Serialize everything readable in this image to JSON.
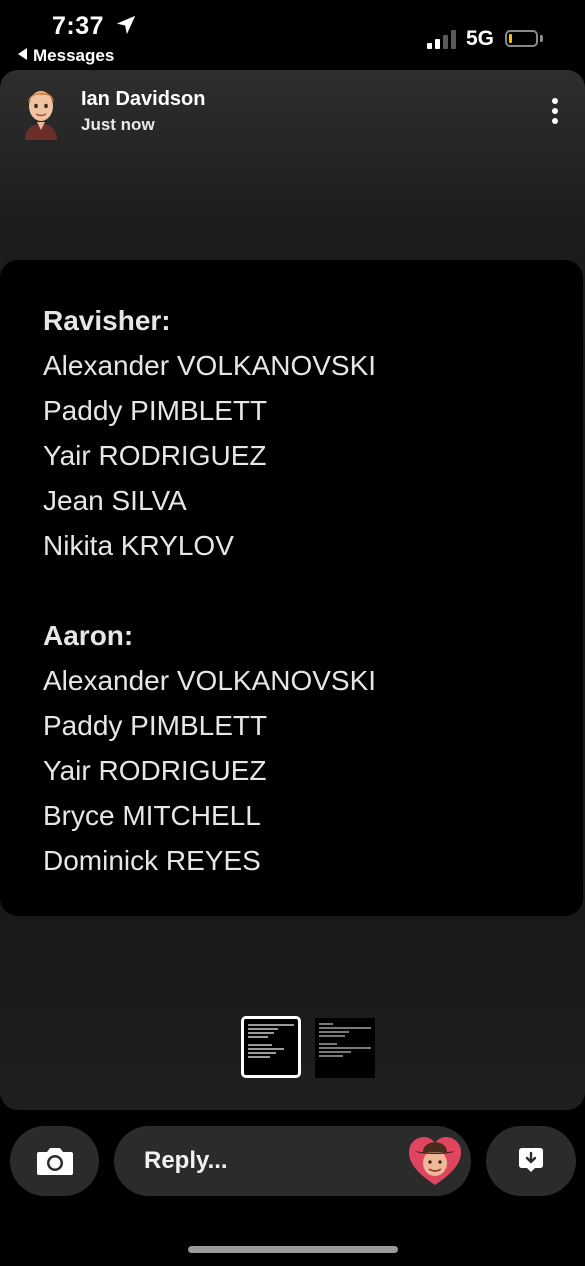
{
  "status": {
    "time": "7:37",
    "back_app": "Messages",
    "network": "5G",
    "battery_color": "#f4c200"
  },
  "story": {
    "sender_name": "Ian Davidson",
    "timestamp": "Just now",
    "more_icon": "more-vertical-icon",
    "lists": [
      {
        "heading": "Ravisher:",
        "items": [
          "Alexander VOLKANOVSKI",
          "Paddy PIMBLETT",
          "Yair RODRIGUEZ",
          "Jean SILVA",
          "Nikita KRYLOV"
        ]
      },
      {
        "heading": "Aaron:",
        "items": [
          "Alexander VOLKANOVSKI",
          "Paddy PIMBLETT",
          "Yair RODRIGUEZ",
          "Bryce MITCHELL",
          "Dominick REYES"
        ]
      }
    ],
    "thumbnails": 2,
    "active_thumbnail": 1
  },
  "bottom": {
    "camera_icon": "camera-icon",
    "reply_placeholder": "Reply...",
    "reaction_icon": "cowboy-heart-reaction-icon",
    "share_icon": "save-download-icon"
  }
}
